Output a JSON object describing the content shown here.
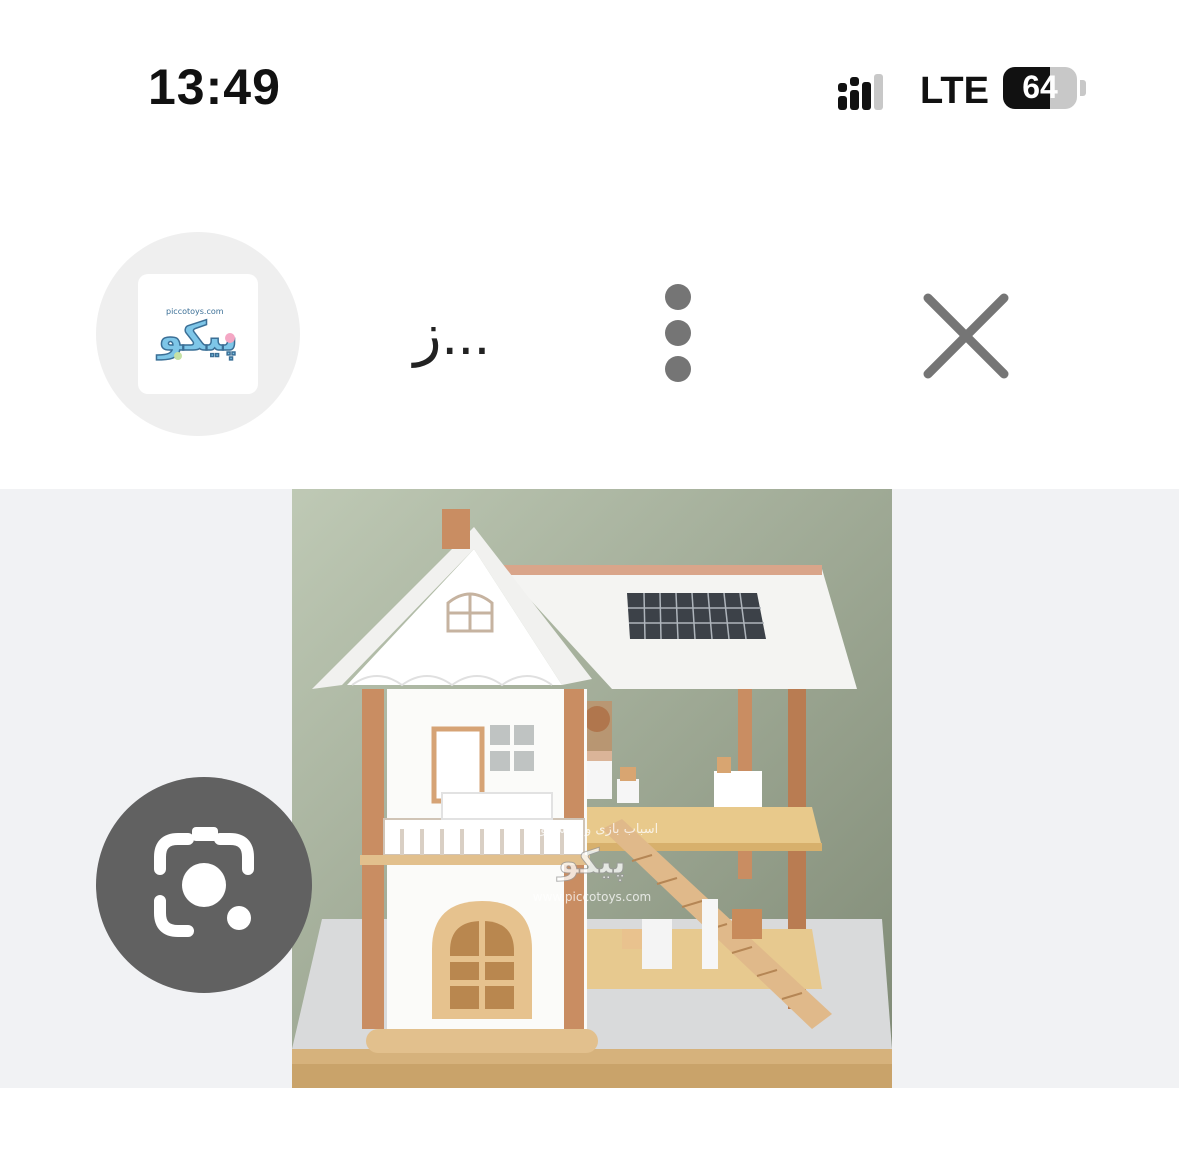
{
  "status_bar": {
    "time": "13:49",
    "network": "LTE",
    "battery": "64",
    "battery_level": 0.64,
    "signal_icon": "signal-icon"
  },
  "header": {
    "site_logo_text": "پیکو",
    "site_logo_subtext": "piccotoys.com",
    "title": "...ز",
    "more_icon": "more-vertical-icon",
    "close_icon": "close-icon"
  },
  "image": {
    "watermark_line1": "اسباب بازی و سیسمونی",
    "watermark_line2": "پیکو",
    "watermark_url": "www.piccotoys.com"
  },
  "lens_button": {
    "icon": "google-lens-icon"
  },
  "colors": {
    "icon_gray": "#757575",
    "lens_bg": "#616161",
    "image_band_bg": "#f1f2f4",
    "wall_green": "#a9b79c"
  }
}
